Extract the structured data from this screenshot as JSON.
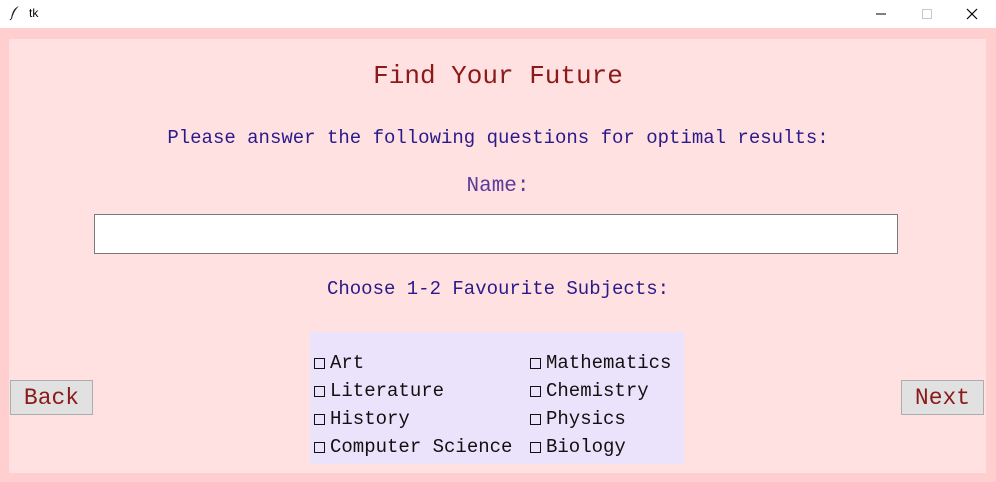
{
  "window": {
    "title": "tk"
  },
  "form": {
    "title": "Find Your Future",
    "instructions": "Please answer the following questions for optimal results:",
    "name_label": "Name:",
    "name_value": "",
    "subjects_label": "Choose 1-2 Favourite Subjects:",
    "subjects": [
      {
        "label": "Art",
        "checked": false
      },
      {
        "label": "Mathematics",
        "checked": false
      },
      {
        "label": "Literature",
        "checked": false
      },
      {
        "label": "Chemistry",
        "checked": false
      },
      {
        "label": "History",
        "checked": false
      },
      {
        "label": "Physics",
        "checked": false
      },
      {
        "label": "Computer Science",
        "checked": false
      },
      {
        "label": "Biology",
        "checked": false
      }
    ]
  },
  "nav": {
    "back_label": "Back",
    "next_label": "Next"
  },
  "colors": {
    "window_bg": "#ffcfcf",
    "content_bg": "#ffe1e1",
    "panel_bg": "#ebe3fb",
    "title_color": "#8b1a1a",
    "text_color": "#2a1a8b",
    "label_color": "#5a3a9a"
  },
  "icons": {
    "app": "feather-icon",
    "minimize": "minimize-icon",
    "maximize": "maximize-icon",
    "close": "close-icon"
  }
}
